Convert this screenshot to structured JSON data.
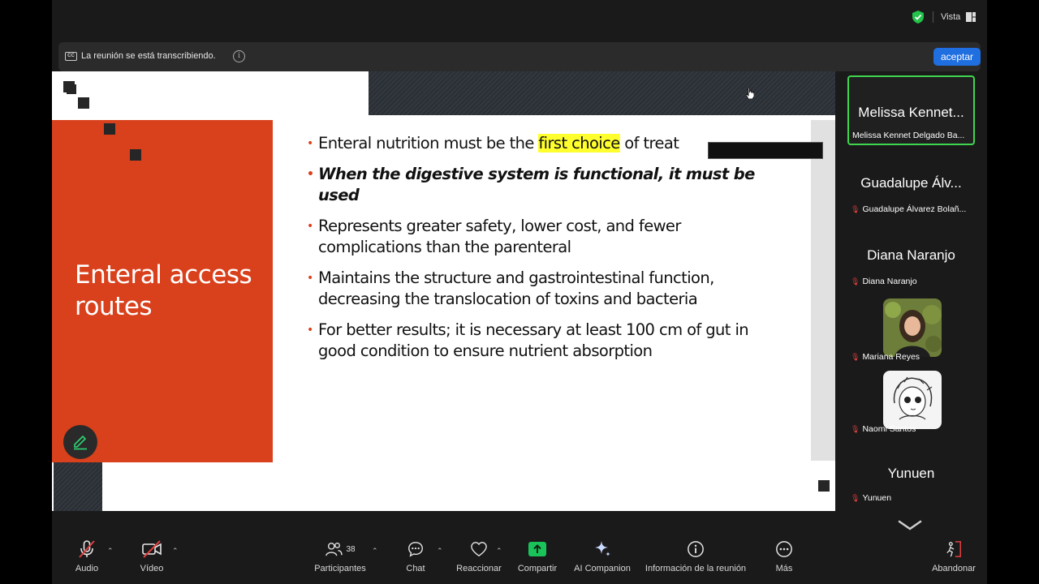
{
  "topbar": {
    "view_label": "Vista"
  },
  "banner": {
    "cc_text": "CC",
    "text": "La reunión se está transcribiendo.",
    "info_glyph": "i",
    "accept_label": "aceptar",
    "accept_color": "#1f6fe0"
  },
  "slide": {
    "title": "Enteral access routes",
    "accent_color": "#d9401c",
    "bullets": [
      {
        "pre": "Enteral nutrition must be the ",
        "highlight": "first choice",
        "post": " of treat"
      },
      {
        "text": "When the digestive system is functional, it must be used"
      },
      {
        "text": "Represents  greater safety, lower cost, and fewer complications than the parenteral"
      },
      {
        "text": "Maintains the structure and gastrointestinal function, decreasing the translocation of toxins and bacteria"
      },
      {
        "text": "For better results; it is necessary at least 100 cm of gut in good condition to ensure nutrient absorption"
      }
    ]
  },
  "participants": [
    {
      "big_name": "Melissa Kennet...",
      "label": "Melissa Kennet Delgado Ba...",
      "active": true,
      "muted": false
    },
    {
      "big_name": "Guadalupe Álv...",
      "label": "Guadalupe Álvarez Bolañ...",
      "muted": true
    },
    {
      "big_name": "Diana Naranjo",
      "label": "Diana Naranjo",
      "muted": true
    },
    {
      "label": "Mariana  Reyes",
      "muted": true,
      "avatar": "photo-avatar"
    },
    {
      "label": "Naomi Santos",
      "muted": true,
      "avatar": "drawing-avatar"
    },
    {
      "big_name": "Yunuen",
      "label": "Yunuen",
      "muted": true
    }
  ],
  "toolbar": {
    "audio": "Audio",
    "video": "Vídeo",
    "participants": "Participantes",
    "participants_count": "38",
    "chat": "Chat",
    "react": "Reaccionar",
    "share": "Compartir",
    "ai": "AI Companion",
    "info": "Información de la reunión",
    "more": "Más",
    "leave": "Abandonar",
    "share_color": "#19c35a",
    "mute_color": "#e04040"
  }
}
